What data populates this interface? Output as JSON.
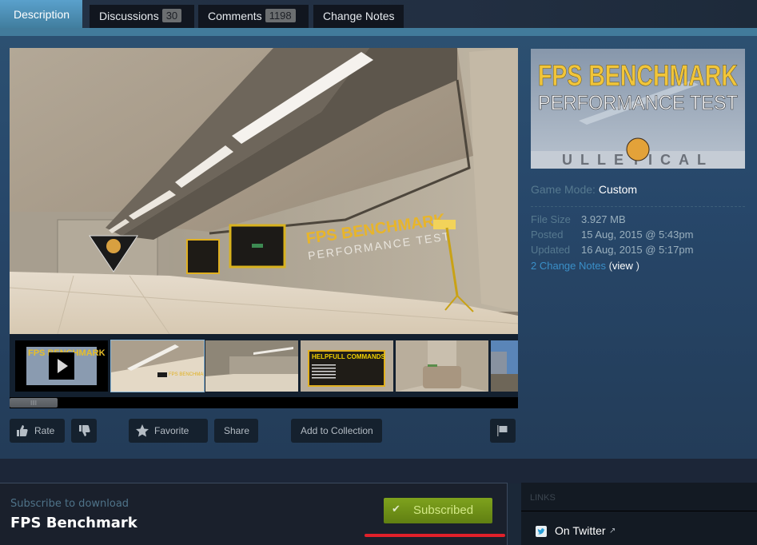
{
  "tabs": [
    {
      "label": "Description",
      "active": true
    },
    {
      "label": "Discussions",
      "badge": "30"
    },
    {
      "label": "Comments",
      "badge": "1198"
    },
    {
      "label": "Change Notes"
    }
  ],
  "preview": {
    "title_line1": "FPS BENCHMARK",
    "title_line2": "PERFORMANCE TEST",
    "brand": "ULLETICAL"
  },
  "main_screenshot": {
    "wall_title_line1": "FPS BENCHMARK",
    "wall_title_line2": "PERFORMANCE TEST"
  },
  "thumbnails": [
    {
      "kind": "video",
      "label": "FPS BENCHMARK"
    },
    {
      "kind": "image",
      "selected": true
    },
    {
      "kind": "image"
    },
    {
      "kind": "image",
      "label": "HELPFULL COMMANDS"
    },
    {
      "kind": "image"
    },
    {
      "kind": "image"
    }
  ],
  "details": {
    "game_mode_label": "Game Mode:",
    "game_mode_value": "Custom",
    "rows": [
      {
        "label": "File Size",
        "value": "3.927 MB"
      },
      {
        "label": "Posted",
        "value": "15 Aug, 2015 @ 5:43pm"
      },
      {
        "label": "Updated",
        "value": "16 Aug, 2015 @ 5:17pm"
      }
    ],
    "change_notes_link": "2 Change Notes",
    "view_open": "(",
    "view_link": "view",
    "view_close": ")"
  },
  "actions": {
    "rate": "Rate",
    "favorite": "Favorite",
    "share": "Share",
    "add_to_collection": "Add to Collection"
  },
  "subscribe": {
    "caption": "Subscribe to download",
    "item_title": "FPS Benchmark",
    "button_label": "Subscribed",
    "button_color": "#75991b",
    "underline_color": "#e0202a"
  },
  "links": {
    "heading": "LINKS",
    "items": [
      {
        "label": "On Twitter"
      }
    ]
  }
}
